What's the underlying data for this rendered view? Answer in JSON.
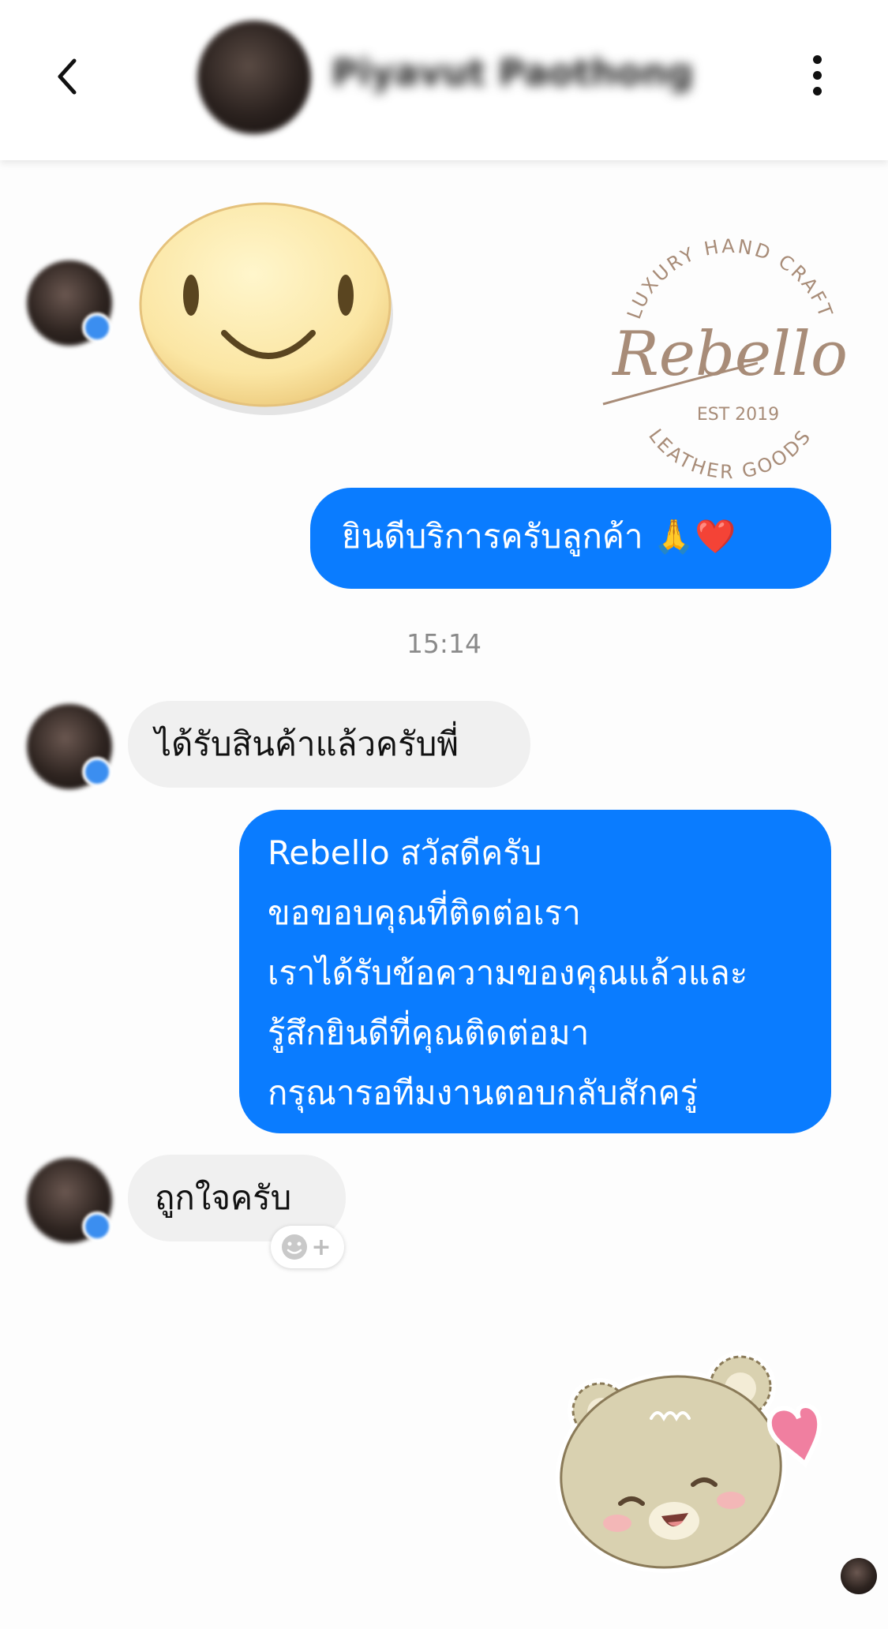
{
  "header": {
    "contact_name": "Piyavut Paothong",
    "back_icon": "chevron-left-icon",
    "more_icon": "more-vertical-icon"
  },
  "messages": [
    {
      "direction": "in",
      "type": "sticker",
      "sticker": "smiling-face-sticker"
    },
    {
      "direction": "out",
      "type": "text",
      "text": "ยินดีบริการครับลูกค้า 🙏❤️"
    },
    {
      "direction": "in",
      "type": "text",
      "text": "ได้รับสินค้าแล้วครับพี่"
    },
    {
      "direction": "out",
      "type": "text",
      "lines": [
        "Rebello สวัสดีครับ",
        "ขอขอบคุณที่ติดต่อเรา",
        "เราได้รับข้อความของคุณแล้วและ",
        "รู้สึกยินดีที่คุณติดต่อมา",
        "กรุณารอทีมงานตอบกลับสักครู่"
      ]
    },
    {
      "direction": "in",
      "type": "text",
      "text": "ถูกใจครับ"
    },
    {
      "direction": "out",
      "type": "sticker",
      "sticker": "bear-heart-sticker"
    }
  ],
  "timestamp": "15:14",
  "watermark": {
    "top_text": "LUXURY HAND CRAFT",
    "brand": "Rebello",
    "est": "EST 2019",
    "bottom_text": "LEATHER GOODS"
  },
  "reaction_button": {
    "icon": "add-reaction-icon",
    "plus": "+"
  },
  "colors": {
    "outgoing_bubble": "#0a7cff",
    "incoming_bubble": "#f0f0f0",
    "watermark": "#a88c78"
  }
}
